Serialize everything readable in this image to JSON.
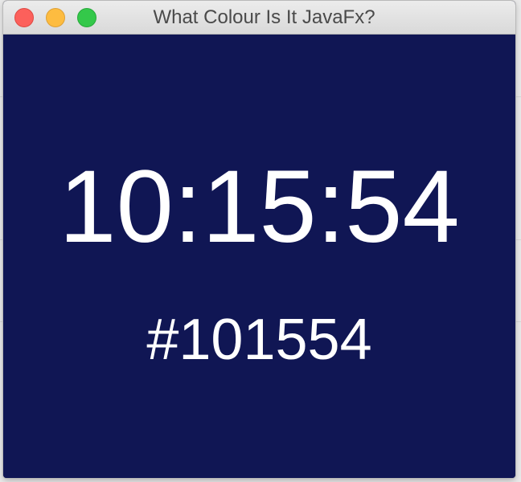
{
  "window": {
    "title": "What Colour Is It JavaFx?"
  },
  "clock": {
    "time": "10:15:54",
    "hex": "#101554"
  },
  "colors": {
    "background": "#101654",
    "text": "#ffffff"
  }
}
